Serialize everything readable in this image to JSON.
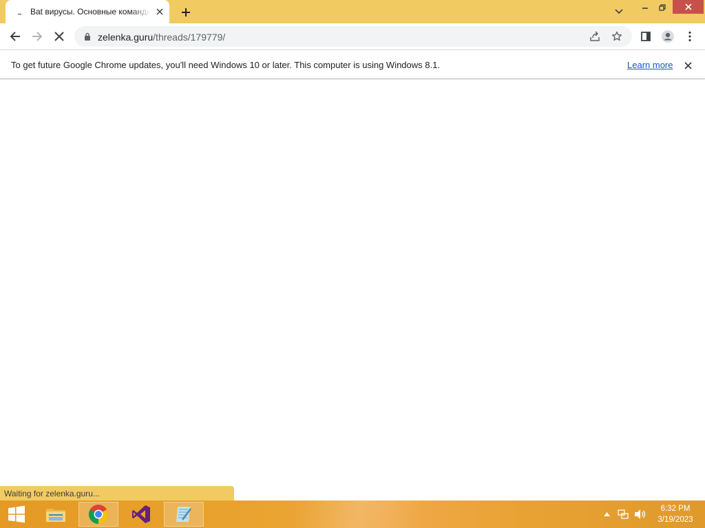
{
  "browser": {
    "tab": {
      "title": "Bat вирусы. Основные команды",
      "close_icon": "close-icon"
    },
    "new_tab_icon": "plus-icon",
    "tab_search_icon": "chevron-down-icon",
    "window_controls": [
      "minimize-icon",
      "restore-icon",
      "close-icon"
    ],
    "toolbar": {
      "back_icon": "arrow-left-icon",
      "forward_icon": "arrow-right-icon",
      "stop_icon": "close-icon",
      "url_host": "zelenka.guru",
      "url_path": "/threads/179779/",
      "share_icon": "share-icon",
      "bookmark_icon": "star-icon",
      "side_panel_icon": "side-panel-icon",
      "profile_icon": "avatar-icon",
      "menu_icon": "kebab-menu-icon"
    },
    "infobar": {
      "message": "To get future Google Chrome updates, you'll need Windows 10 or later. This computer is using Windows 8.1.",
      "link": "Learn more"
    },
    "status": "Waiting for zelenka.guru..."
  },
  "taskbar": {
    "apps": [
      {
        "name": "file-explorer",
        "icon": "folder-icon",
        "active": false
      },
      {
        "name": "google-chrome",
        "icon": "chrome-icon",
        "active": true
      },
      {
        "name": "visual-studio",
        "icon": "visual-studio-icon",
        "active": false
      },
      {
        "name": "notepad",
        "icon": "notepad-icon",
        "active": true
      }
    ],
    "clock": {
      "time": "6:32 PM",
      "date": "3/19/2023"
    }
  },
  "colors": {
    "frame": "#f1cb62",
    "taskbar": "#e89f2b",
    "link": "#1a57b8",
    "close_button": "#c7504a"
  }
}
